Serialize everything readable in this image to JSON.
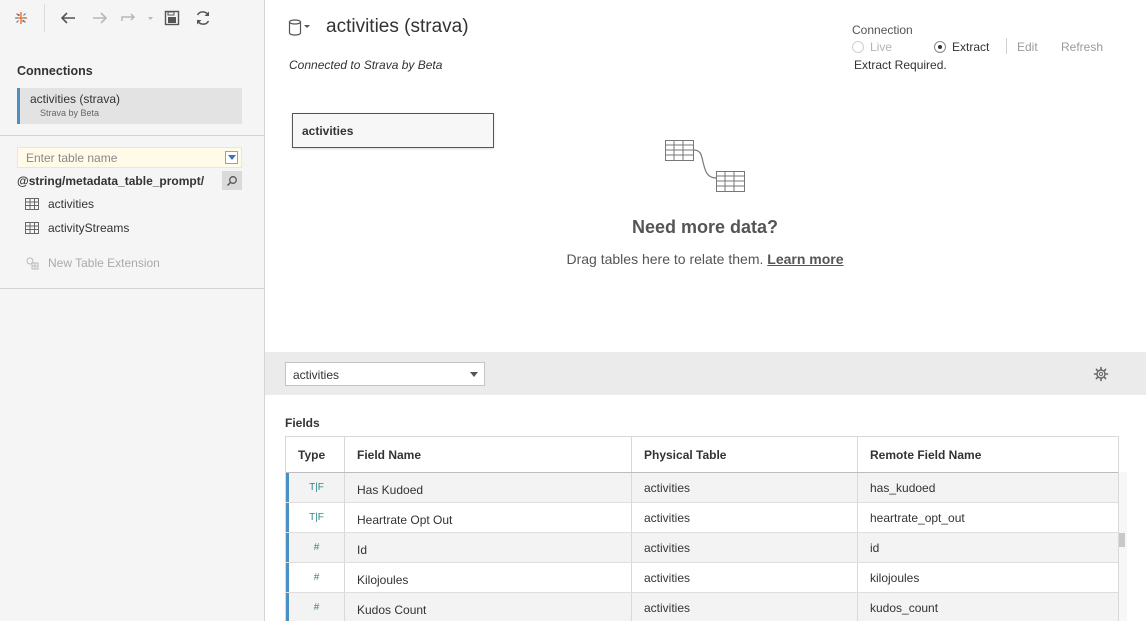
{
  "toolbar": {
    "icons": [
      "tableau-logo-icon",
      "back-arrow-icon",
      "forward-arrow-icon",
      "redo-icon",
      "save-icon",
      "refresh-icon"
    ]
  },
  "sidebar": {
    "connections_title": "Connections",
    "connection": {
      "name": "activities (strava)",
      "subtitle": "Strava by Beta"
    },
    "table_search_placeholder": "Enter table name",
    "schema_label": "@string/metadata_table_prompt/",
    "tables": [
      {
        "label": "activities"
      },
      {
        "label": "activityStreams"
      }
    ],
    "new_extension": "New Table Extension"
  },
  "header": {
    "title": "activities (strava)",
    "subtitle": "Connected to Strava by Beta"
  },
  "connection_panel": {
    "label": "Connection",
    "live": "Live",
    "extract": "Extract",
    "selected": "Extract",
    "edit": "Edit",
    "refresh": "Refresh",
    "status": "Extract Required."
  },
  "canvas": {
    "table_box": "activities",
    "need_title": "Need more data?",
    "need_text": "Drag tables here to relate them.",
    "learn_more": "Learn more"
  },
  "grid_toolbar": {
    "table_select": "activities"
  },
  "fields": {
    "label": "Fields",
    "columns": [
      "Type",
      "Field Name",
      "Physical Table",
      "Remote Field Name"
    ],
    "rows": [
      {
        "type": "T|F",
        "field": "Has Kudoed",
        "table": "activities",
        "remote": "has_kudoed"
      },
      {
        "type": "T|F",
        "field": "Heartrate Opt Out",
        "table": "activities",
        "remote": "heartrate_opt_out"
      },
      {
        "type": "#",
        "field": "Id",
        "table": "activities",
        "remote": "id"
      },
      {
        "type": "#",
        "field": "Kilojoules",
        "table": "activities",
        "remote": "kilojoules"
      },
      {
        "type": "#",
        "field": "Kudos Count",
        "table": "activities",
        "remote": "kudos_count"
      }
    ]
  },
  "colors": {
    "accent": "#4e8fc1",
    "type_icon": "#2e8a8a",
    "search_bg": "#fffbe8"
  }
}
